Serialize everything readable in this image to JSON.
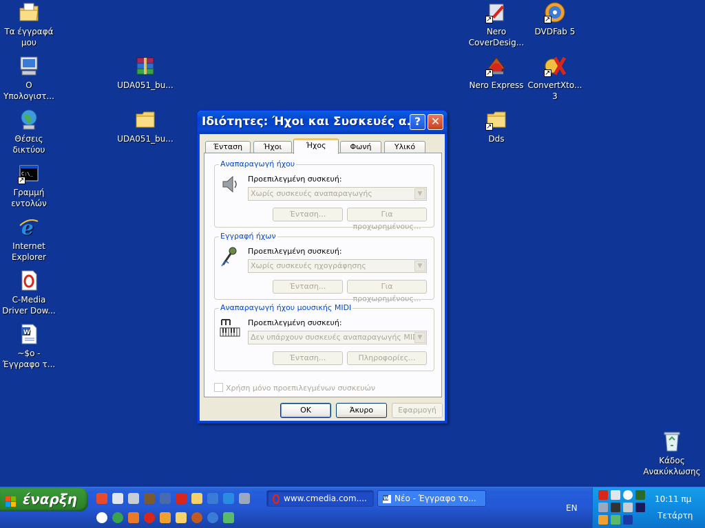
{
  "desktop": {
    "icons": [
      {
        "label": "Τα έγγραφά μου",
        "icon": "my-documents-icon"
      },
      {
        "label": "Ο Υπολογιστ...",
        "icon": "my-computer-icon"
      },
      {
        "label": "Θέσεις δικτύου",
        "icon": "network-places-icon"
      },
      {
        "label": "Γραμμή εντολών",
        "icon": "command-prompt-icon"
      },
      {
        "label": "Internet Explorer",
        "icon": "internet-explorer-icon"
      },
      {
        "label": "C-Media Driver Dow...",
        "icon": "opera-icon"
      },
      {
        "label": "~$ο - Έγγραφο τ...",
        "icon": "word-document-icon"
      },
      {
        "label": "UDA051_bu...",
        "icon": "winrar-archive-icon"
      },
      {
        "label": "UDA051_bu...",
        "icon": "folder-icon"
      },
      {
        "label": "Nero CoverDesig...",
        "icon": "nero-coverdesigner-icon"
      },
      {
        "label": "DVDFab 5",
        "icon": "dvdfab-icon"
      },
      {
        "label": "Nero Express",
        "icon": "nero-express-icon"
      },
      {
        "label": "ConvertXto... 3",
        "icon": "convertxtodvd-icon"
      },
      {
        "label": "Dds",
        "icon": "folder-icon"
      },
      {
        "label": "Κάδος Ανακύκλωσης",
        "icon": "recycle-bin-icon"
      }
    ]
  },
  "dialog": {
    "title": "Ιδιότητες: Ήχοι και Συσκευές α...",
    "help": "?",
    "close": "✕",
    "tabs": [
      {
        "label": "Ένταση",
        "active": false
      },
      {
        "label": "Ήχοι",
        "active": false
      },
      {
        "label": "Ήχος",
        "active": true
      },
      {
        "label": "Φωνή",
        "active": false
      },
      {
        "label": "Υλικό",
        "active": false
      }
    ],
    "groups": [
      {
        "title": "Αναπαραγωγή ήχου",
        "device_label": "Προεπιλεγμένη συσκευή:",
        "device_value": "Χωρίς συσκευές αναπαραγωγής",
        "btn1": "Ένταση...",
        "btn2": "Για προχωρημένους..."
      },
      {
        "title": "Εγγραφή ήχων",
        "device_label": "Προεπιλεγμένη συσκευή:",
        "device_value": "Χωρίς συσκευές ηχογράφησης",
        "btn1": "Ένταση...",
        "btn2": "Για προχωρημένους..."
      },
      {
        "title": "Αναπαραγωγή ήχου μουσικής MIDI",
        "device_label": "Προεπιλεγμένη συσκευή:",
        "device_value": "Δεν υπάρχουν συσκευές αναπαραγωγής MIDI",
        "btn1": "Ένταση...",
        "btn2": "Πληροφορίες..."
      }
    ],
    "checkbox_label": "Χρήση μόνο προεπιλεγμένων συσκευών",
    "ok": "OK",
    "cancel": "Άκυρο",
    "apply": "Εφαρμογή"
  },
  "taskbar": {
    "start": "έναρξη",
    "buttons": [
      {
        "label": "www.cmedia.com....",
        "icon": "opera-icon",
        "active": true
      },
      {
        "label": "Νέο - Έγγραφο το...",
        "icon": "word-document-icon",
        "active": false
      }
    ],
    "language": "EN",
    "time": "10:11 πμ",
    "day": "Τετάρτη"
  },
  "colors": {
    "desktop": "#0f3697",
    "titlebar": "#0243c9",
    "taskbar": "#245edb",
    "start": "#2f8a2d",
    "tray": "#0f8ae0",
    "group_title": "#0046d5"
  }
}
